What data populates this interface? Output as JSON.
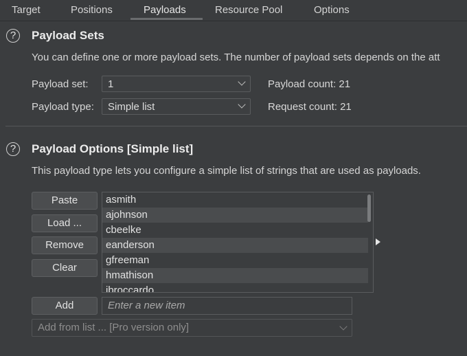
{
  "tabs": [
    {
      "label": "Target"
    },
    {
      "label": "Positions"
    },
    {
      "label": "Payloads"
    },
    {
      "label": "Resource Pool"
    },
    {
      "label": "Options"
    }
  ],
  "active_tab": "Payloads",
  "payload_sets": {
    "help_icon": "?",
    "title": "Payload Sets",
    "description": "You can define one or more payload sets. The number of payload sets depends on the att",
    "set_label": "Payload set:",
    "set_value": "1",
    "type_label": "Payload type:",
    "type_value": "Simple list",
    "payload_count": "Payload count: 21",
    "request_count": "Request count: 21"
  },
  "payload_options": {
    "help_icon": "?",
    "title": "Payload Options [Simple list]",
    "description": "This payload type lets you configure a simple list of strings that are used as payloads.",
    "buttons": {
      "paste": "Paste",
      "load": "Load ...",
      "remove": "Remove",
      "clear": "Clear",
      "add": "Add"
    },
    "items": [
      "asmith",
      "ajohnson",
      "cbeelke",
      "eanderson",
      "gfreeman",
      "hmathison",
      "ibroccardo"
    ],
    "new_item_placeholder": "Enter a new item",
    "add_from_list": "Add from list ... [Pro version only]"
  },
  "colors": {
    "background": "#3b3d3f",
    "text": "#dcdcdc",
    "alt_row": "#4a4c4e"
  },
  "icons": [
    "help-icon",
    "chevron-down-icon",
    "play-arrow-icon"
  ]
}
